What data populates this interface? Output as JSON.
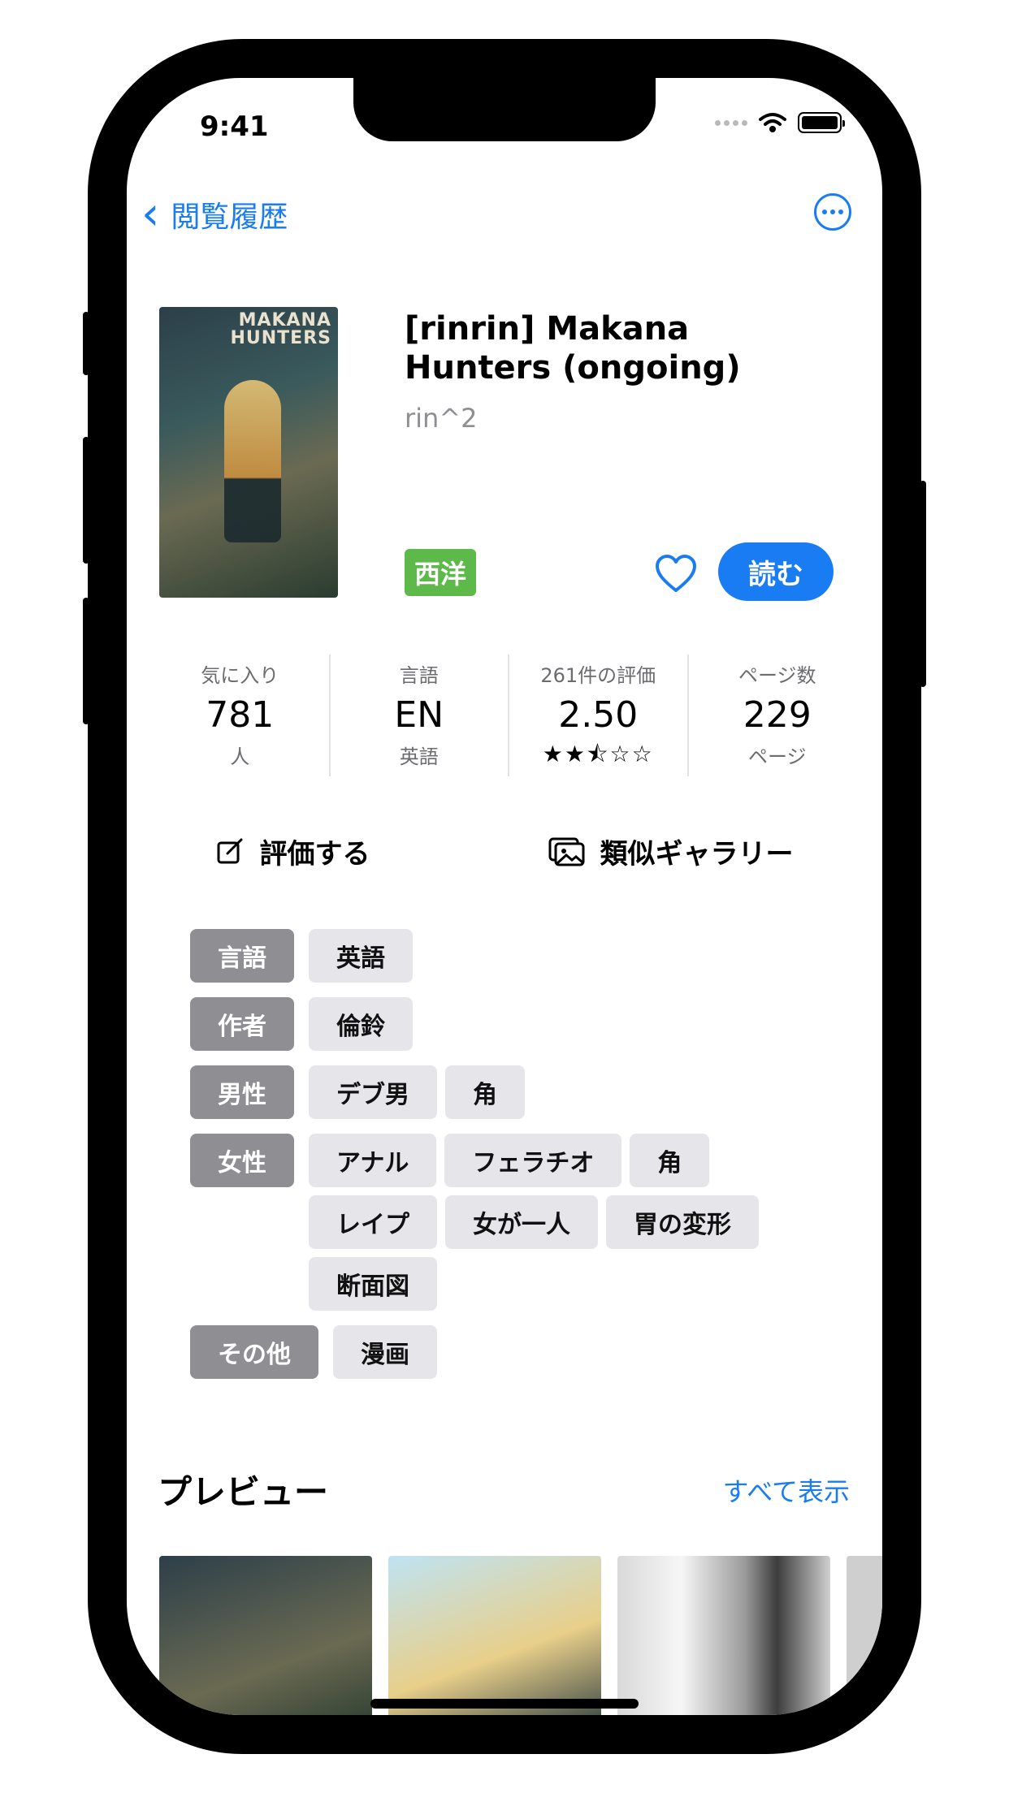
{
  "status": {
    "time": "9:41"
  },
  "nav": {
    "back_label": "閲覧履歴"
  },
  "gallery": {
    "title": "[rinrin] Makana Hunters (ongoing)",
    "author": "rin^2",
    "category": "西洋",
    "category_color": "#5cb94a",
    "read_label": "読む",
    "cover_logo_line1": "MAKANA",
    "cover_logo_line2": "HUNTERS"
  },
  "stats": [
    {
      "top": "気に入り",
      "value": "781",
      "bottom": "人"
    },
    {
      "top": "言語",
      "value": "EN",
      "bottom": "英語"
    },
    {
      "top": "261件の評価",
      "value": "2.50",
      "stars": "★★⯪☆☆"
    },
    {
      "top": "ページ数",
      "value": "229",
      "bottom": "ページ"
    }
  ],
  "actions": {
    "rate_label": "評価する",
    "similar_label": "類似ギャラリー"
  },
  "tags": [
    {
      "key": "言語",
      "values": [
        "英語"
      ]
    },
    {
      "key": "作者",
      "values": [
        "倫鈴"
      ]
    },
    {
      "key": "男性",
      "values": [
        "デブ男",
        "角"
      ]
    },
    {
      "key": "女性",
      "values": [
        "アナル",
        "フェラチオ",
        "角",
        "レイプ",
        "女が一人",
        "胃の変形",
        "断面図"
      ]
    },
    {
      "key": "その他",
      "values": [
        "漫画"
      ]
    }
  ],
  "preview": {
    "title": "プレビュー",
    "show_all": "すべて表示"
  },
  "colors": {
    "accent": "#1a7cf2",
    "tag_key_bg": "#8e8e93",
    "tag_value_bg": "#e5e5ea"
  }
}
